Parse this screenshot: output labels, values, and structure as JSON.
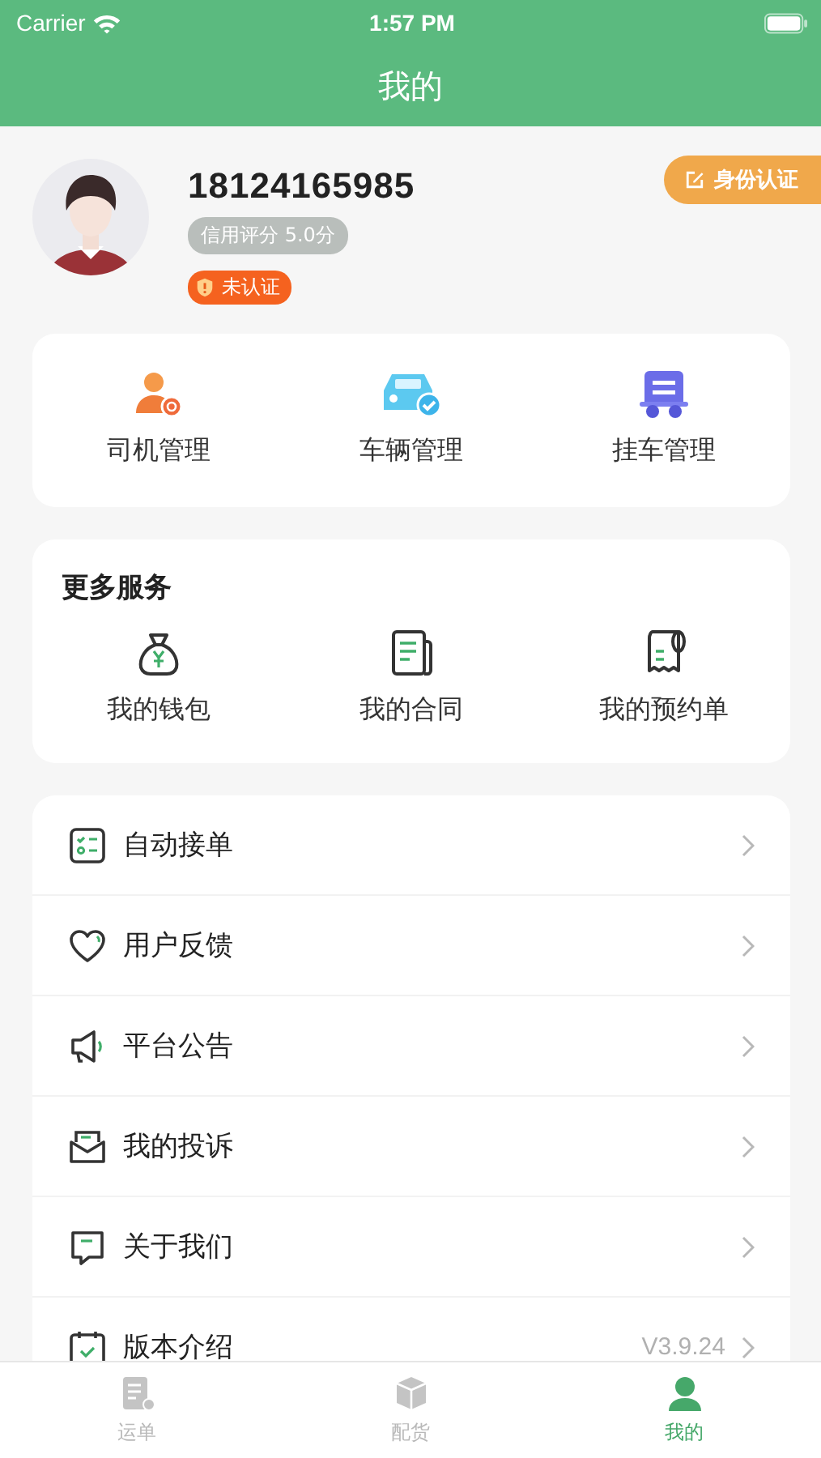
{
  "status_bar": {
    "carrier": "Carrier",
    "time": "1:57 PM"
  },
  "nav": {
    "title": "我的"
  },
  "profile": {
    "phone": "18124165985",
    "credit": "信用评分 5.0分",
    "verify_badge": "未认证",
    "verify_button": "身份认证"
  },
  "manage": [
    {
      "label": "司机管理"
    },
    {
      "label": "车辆管理"
    },
    {
      "label": "挂车管理"
    }
  ],
  "services": {
    "title": "更多服务",
    "items": [
      {
        "label": "我的钱包"
      },
      {
        "label": "我的合同"
      },
      {
        "label": "我的预约单"
      }
    ]
  },
  "menu": [
    {
      "label": "自动接单"
    },
    {
      "label": "用户反馈"
    },
    {
      "label": "平台公告"
    },
    {
      "label": "我的投诉"
    },
    {
      "label": "关于我们"
    },
    {
      "label": "版本介绍",
      "value": "V3.9.24"
    }
  ],
  "tabs": [
    {
      "label": "运单",
      "selected": false
    },
    {
      "label": "配货",
      "selected": false
    },
    {
      "label": "我的",
      "selected": true
    }
  ]
}
